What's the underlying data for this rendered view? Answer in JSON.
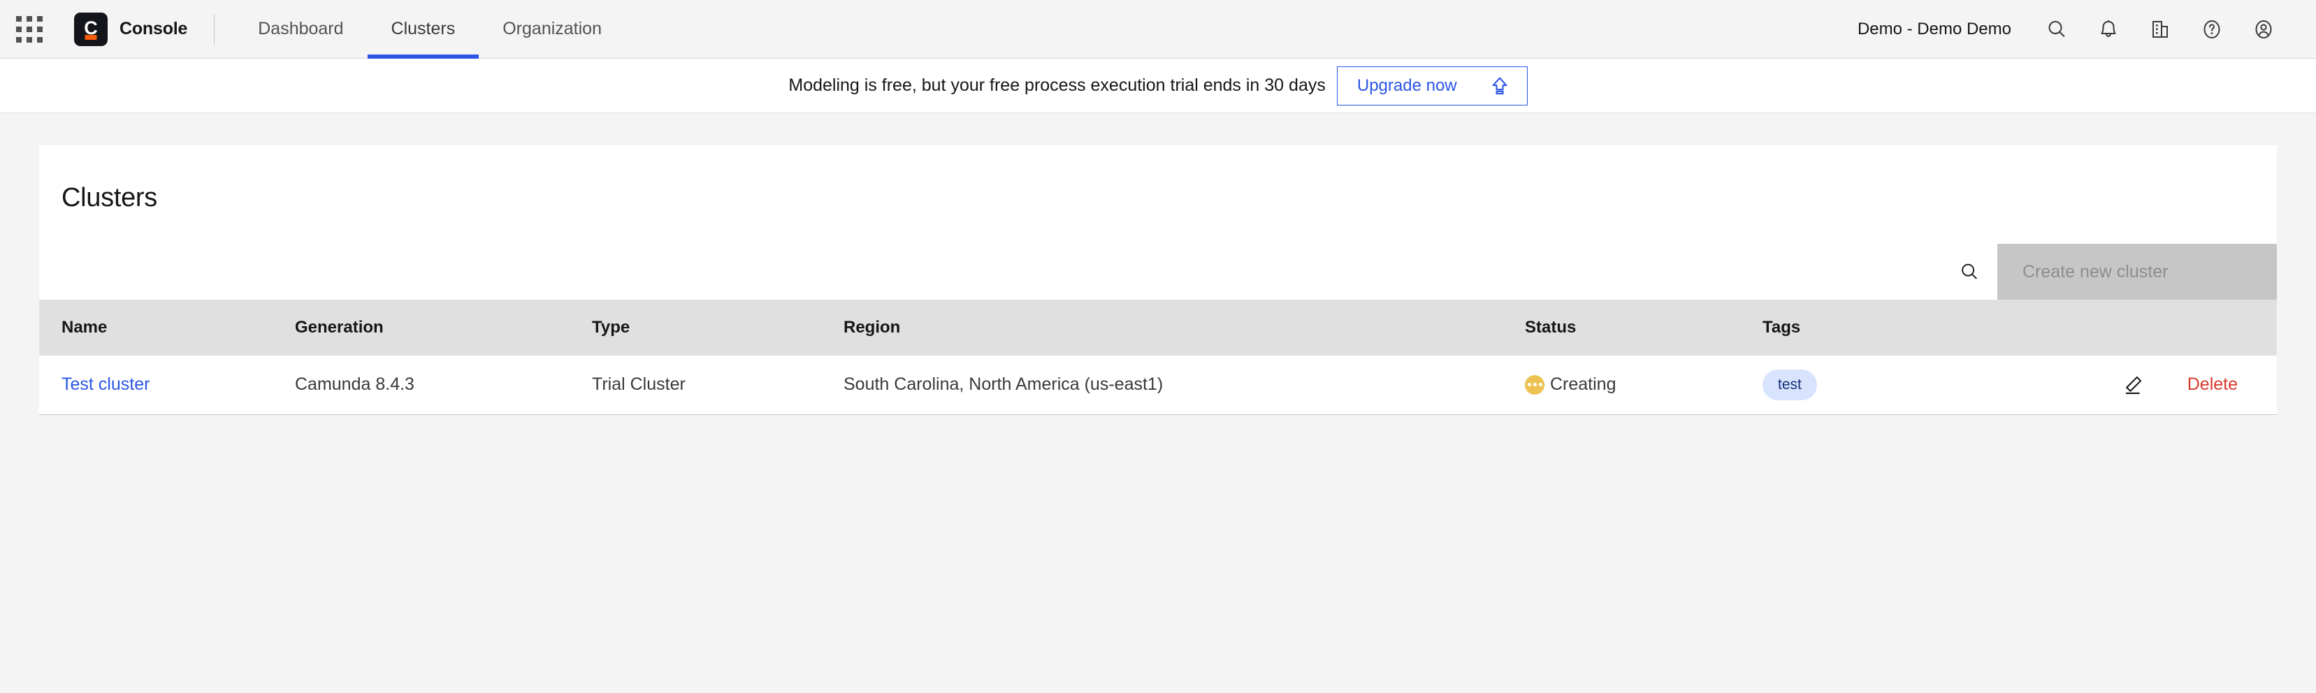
{
  "topbar": {
    "app_switcher_icon": "grid-apps-icon",
    "brand_name": "Console",
    "logo_letter": "C",
    "tabs": [
      {
        "label": "Dashboard",
        "active": false
      },
      {
        "label": "Clusters",
        "active": true
      },
      {
        "label": "Organization",
        "active": false
      }
    ],
    "org_name": "Demo - Demo Demo",
    "icons": [
      "search-icon",
      "notification-bell-icon",
      "organization-building-icon",
      "help-circle-icon",
      "user-avatar-icon"
    ]
  },
  "banner": {
    "message": "Modeling is free, but your free process execution trial ends in 30 days",
    "upgrade_label": "Upgrade now",
    "upgrade_icon": "upgrade-arrow-icon",
    "accent_color": "#2b56e4"
  },
  "page": {
    "title": "Clusters",
    "search_icon": "search-icon",
    "create_button_label": "Create new cluster",
    "create_button_disabled": true
  },
  "table": {
    "columns": [
      "Name",
      "Generation",
      "Type",
      "Region",
      "Status",
      "Tags",
      ""
    ],
    "rows": [
      {
        "name": "Test cluster",
        "generation": "Camunda 8.4.3",
        "type": "Trial Cluster",
        "region": "South Carolina, North America (us-east1)",
        "status": "Creating",
        "status_color": "#edc253",
        "tags": [
          "test"
        ],
        "edit_label": "edit-icon",
        "delete_label": "Delete",
        "delete_color": "#d9392c"
      }
    ]
  }
}
